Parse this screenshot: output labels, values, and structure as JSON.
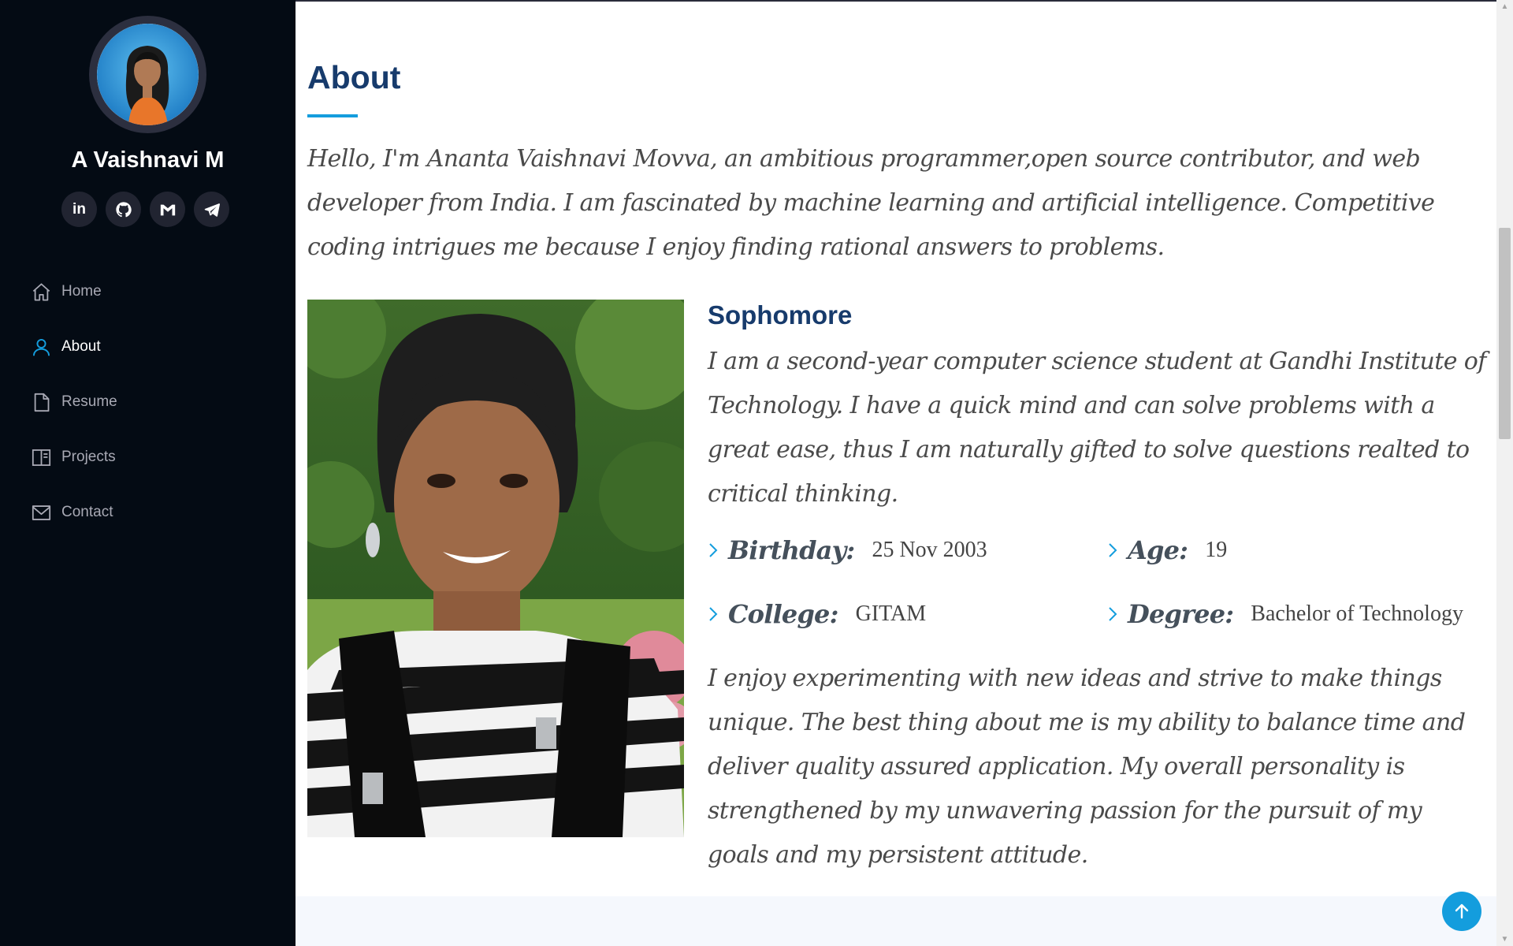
{
  "sidebar": {
    "name": "A Vaishnavi M",
    "social": [
      {
        "icon": "linkedin-icon",
        "text": "in"
      },
      {
        "icon": "github-icon"
      },
      {
        "icon": "gmail-icon"
      },
      {
        "icon": "telegram-icon"
      }
    ],
    "nav": [
      {
        "label": "Home",
        "icon": "home-icon"
      },
      {
        "label": "About",
        "icon": "person-icon",
        "active": true
      },
      {
        "label": "Resume",
        "icon": "file-icon"
      },
      {
        "label": "Projects",
        "icon": "book-icon"
      },
      {
        "label": "Contact",
        "icon": "envelope-icon"
      }
    ]
  },
  "about": {
    "title": "About",
    "intro": "Hello, I'm Ananta Vaishnavi Movva, an ambitious programmer,open source contributor, and web developer from India. I am fascinated by machine learning and artificial intelligence. Competitive coding intrigues me because I enjoy finding rational answers to problems.",
    "subhead": "Sophomore",
    "para1": "I am a second-year computer science student at Gandhi Institute of Technology. I have a quick mind and can solve problems with a great ease, thus I am naturally gifted to solve questions realted to critical thinking.",
    "facts": [
      {
        "label": "Birthday:",
        "value": "25 Nov 2003"
      },
      {
        "label": "Age:",
        "value": "19"
      },
      {
        "label": "College:",
        "value": "GITAM"
      },
      {
        "label": "Degree:",
        "value": "Bachelor of Technology"
      }
    ],
    "para2": "I enjoy experimenting with new ideas and strive to make things unique. The best thing about me is my ability to balance time and deliver quality assured application. My overall personality is strengthened by my unwavering passion for the pursuit of my goals and my persistent attitude."
  },
  "colors": {
    "sidebar_bg": "#040b14",
    "accent": "#149ddd",
    "heading": "#173b6c",
    "nav_text": "#a8a9b4"
  },
  "scroll": {
    "position_fraction": 0.24
  }
}
